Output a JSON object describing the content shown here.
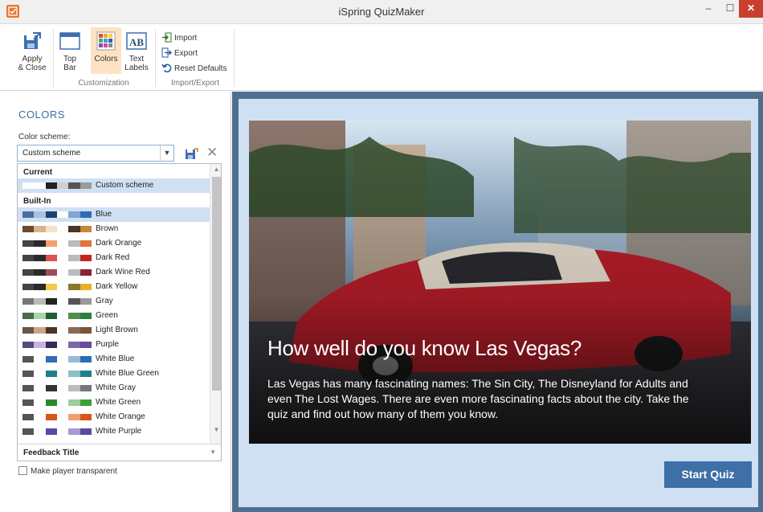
{
  "window": {
    "title": "iSpring QuizMaker",
    "minimize": "–",
    "maximize": "☐",
    "close": "✕"
  },
  "ribbon": {
    "apply_close": {
      "line1": "Apply",
      "line2": "& Close"
    },
    "top_bar": {
      "line1": "Top",
      "line2": "Bar"
    },
    "colors": {
      "line1": "Colors"
    },
    "text_labels": {
      "line1": "Text",
      "line2": "Labels"
    },
    "customization_label": "Customization",
    "import": "Import",
    "export": "Export",
    "reset_defaults": "Reset Defaults",
    "import_export_label": "Import/Export"
  },
  "panel": {
    "title": "COLORS",
    "scheme_label": "Color scheme:",
    "scheme_value": "Custom scheme",
    "current_header": "Current",
    "builtin_header": "Built-In",
    "schemes": [
      {
        "name": "Custom scheme",
        "colors": [
          "#ffffff",
          "#ffffff",
          "#222222",
          "#cfcfcf",
          "#555555",
          "#9a9a9a"
        ]
      },
      {
        "name": "Blue",
        "colors": [
          "#4a6f9c",
          "#a8c2e0",
          "#1f3f73",
          "#ffffff",
          "#7fa6d4",
          "#2d6db4"
        ]
      },
      {
        "name": "Brown",
        "colors": [
          "#6b4a2e",
          "#d7b58a",
          "#f4e3c8",
          "#ffffff",
          "#4a3422",
          "#c8873a"
        ]
      },
      {
        "name": "Dark Orange",
        "colors": [
          "#444444",
          "#2a2a2a",
          "#f2a16b",
          "#ffffff",
          "#bbbbbb",
          "#e0733a"
        ]
      },
      {
        "name": "Dark Red",
        "colors": [
          "#444444",
          "#2a2a2a",
          "#e05050",
          "#ffffff",
          "#bbbbbb",
          "#c42323"
        ]
      },
      {
        "name": "Dark Wine Red",
        "colors": [
          "#444444",
          "#2a2a2a",
          "#a04a5a",
          "#ffffff",
          "#bbbbbb",
          "#8a2333"
        ]
      },
      {
        "name": "Dark Yellow",
        "colors": [
          "#444444",
          "#2a2a2a",
          "#f2c94a",
          "#ffffff",
          "#8a7a2a",
          "#e8b02c"
        ]
      },
      {
        "name": "Gray",
        "colors": [
          "#777777",
          "#bbbbbb",
          "#222222",
          "#ffffff",
          "#555555",
          "#999999"
        ]
      },
      {
        "name": "Green",
        "colors": [
          "#4a6a4a",
          "#a8d5a8",
          "#1f5f2f",
          "#ffffff",
          "#4f8f4f",
          "#2a7f3f"
        ]
      },
      {
        "name": "Light Brown",
        "colors": [
          "#6b5548",
          "#c9a58a",
          "#4a3426",
          "#ffffff",
          "#8a6a55",
          "#7a553a"
        ]
      },
      {
        "name": "Purple",
        "colors": [
          "#5a4a7a",
          "#c4b2e0",
          "#3a2a5a",
          "#ffffff",
          "#7a6aa0",
          "#6a4a9a"
        ]
      },
      {
        "name": "White Blue",
        "colors": [
          "#555555",
          "#ffffff",
          "#2d6db4",
          "#ffffff",
          "#9ab8dc",
          "#2d6db4"
        ]
      },
      {
        "name": "White Blue Green",
        "colors": [
          "#555555",
          "#ffffff",
          "#20808a",
          "#ffffff",
          "#8ac0c6",
          "#20808a"
        ]
      },
      {
        "name": "White Gray",
        "colors": [
          "#555555",
          "#ffffff",
          "#333333",
          "#ffffff",
          "#bbbbbb",
          "#777777"
        ]
      },
      {
        "name": "White Green",
        "colors": [
          "#555555",
          "#ffffff",
          "#2a8a2a",
          "#ffffff",
          "#9ad09a",
          "#3aa03a"
        ]
      },
      {
        "name": "White Orange",
        "colors": [
          "#555555",
          "#ffffff",
          "#d8561a",
          "#ffffff",
          "#f0a070",
          "#d8561a"
        ]
      },
      {
        "name": "White Purple",
        "colors": [
          "#555555",
          "#ffffff",
          "#5a4aa0",
          "#ffffff",
          "#a89ad6",
          "#5a4aa0"
        ]
      }
    ],
    "feedback_title": "Feedback Title",
    "transparent_label": "Make player transparent",
    "transparent_checked": false
  },
  "preview": {
    "headline": "How well do you know Las Vegas?",
    "description": "Las Vegas has many fascinating names: The Sin City, The Disneyland for Adults and even The Lost Wages. There are even more fascinating facts about the city. Take the quiz and find out how many of them you know.",
    "start_button": "Start Quiz"
  },
  "colors": {
    "accent": "#3e6fa6",
    "panel_title": "#3a6ea5",
    "selected": "#cfe0f3",
    "frame": "#4e6f91"
  }
}
